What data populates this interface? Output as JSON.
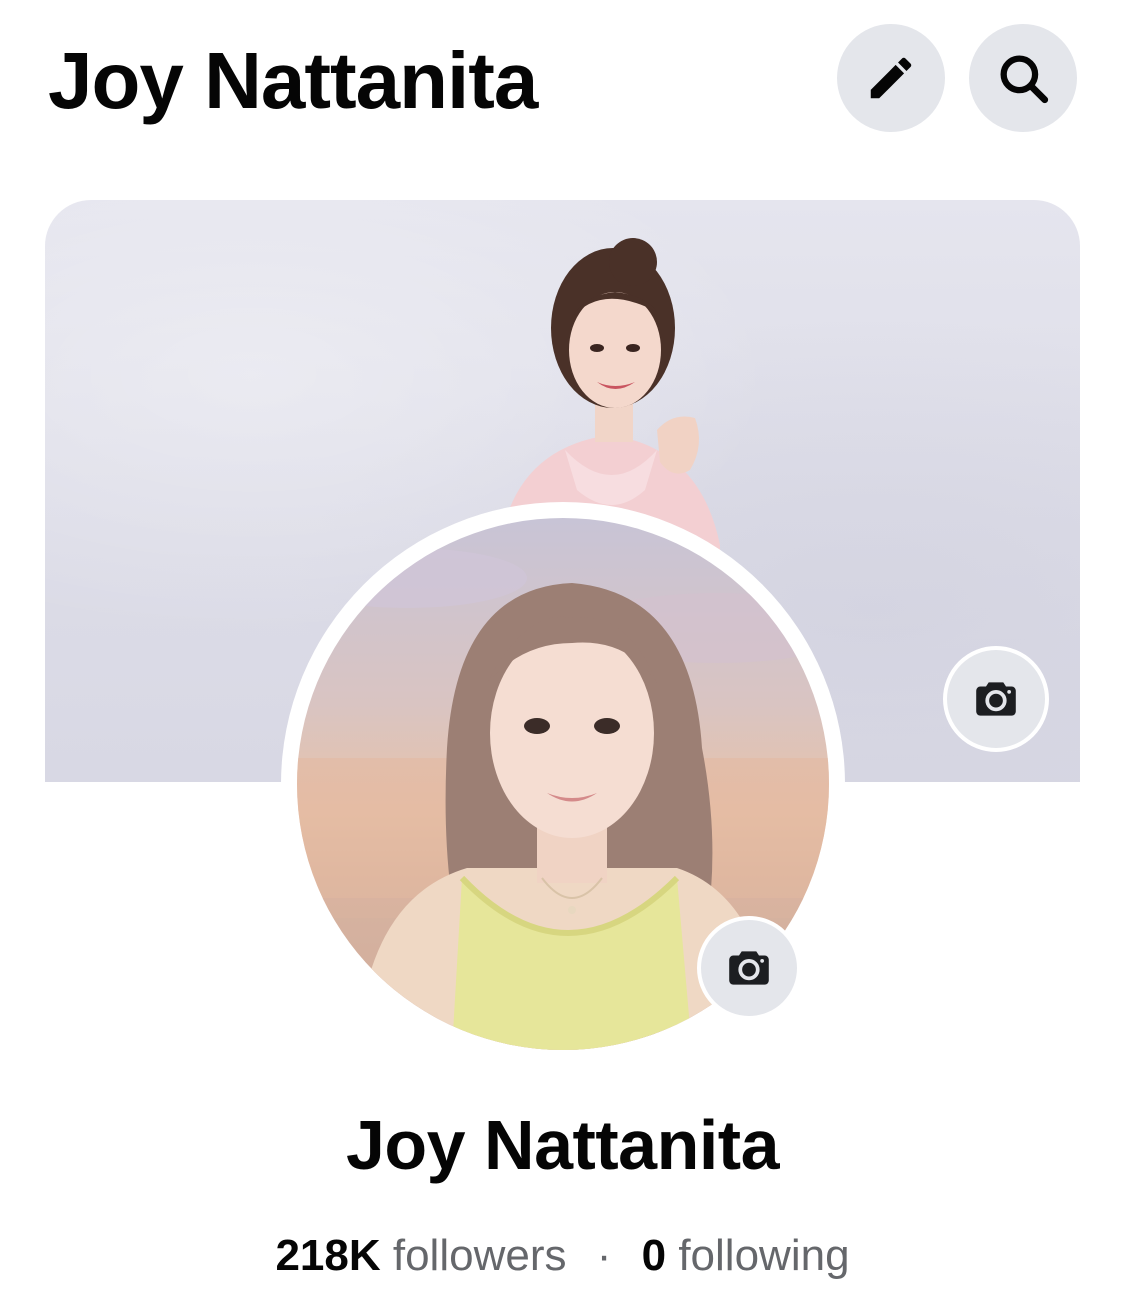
{
  "header": {
    "title": "Joy Nattanita",
    "edit_icon": "pencil-icon",
    "search_icon": "search-icon"
  },
  "cover": {
    "description_icon": "camera-icon"
  },
  "profile": {
    "name": "Joy Nattanita",
    "camera_icon": "camera-icon"
  },
  "stats": {
    "followers_count": "218K",
    "followers_label": "followers",
    "separator": "·",
    "following_count": "0",
    "following_label": "following"
  },
  "colors": {
    "button_bg": "#e4e6eb",
    "text_primary": "#050505",
    "text_secondary": "#65676b"
  }
}
